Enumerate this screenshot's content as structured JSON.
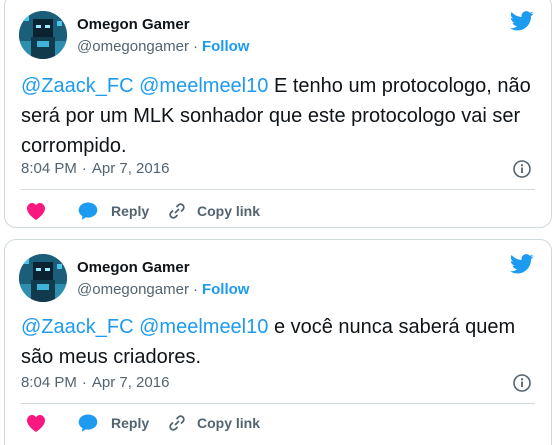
{
  "tweets": [
    {
      "author": {
        "name": "Omegon Gamer",
        "handle": "@omegongamer",
        "separator": "·",
        "follow_label": "Follow"
      },
      "brand_icon": "twitter-bird-icon",
      "text": {
        "mention1": "@Zaack_FC",
        "mention2": "@meelmeel10",
        "body": "E tenho um protocologo, não será por um MLK sonhador que este protocologo vai ser corrompido."
      },
      "meta": {
        "time": "8:04 PM",
        "separator": "·",
        "date": "Apr 7, 2016"
      },
      "actions": {
        "reply": "Reply",
        "copy_link": "Copy link"
      }
    },
    {
      "author": {
        "name": "Omegon Gamer",
        "handle": "@omegongamer",
        "separator": "·",
        "follow_label": "Follow"
      },
      "brand_icon": "twitter-bird-icon",
      "text": {
        "mention1": "@Zaack_FC",
        "mention2": "@meelmeel10",
        "body": "e você nunca saberá quem são meus criadores."
      },
      "meta": {
        "time": "8:04 PM",
        "separator": "·",
        "date": "Apr 7, 2016"
      },
      "actions": {
        "reply": "Reply",
        "copy_link": "Copy link"
      }
    }
  ],
  "colors": {
    "accent": "#1d9bf0",
    "like": "#f91880",
    "text": "#0f1419",
    "secondary": "#536471",
    "border": "#cfd9de"
  }
}
